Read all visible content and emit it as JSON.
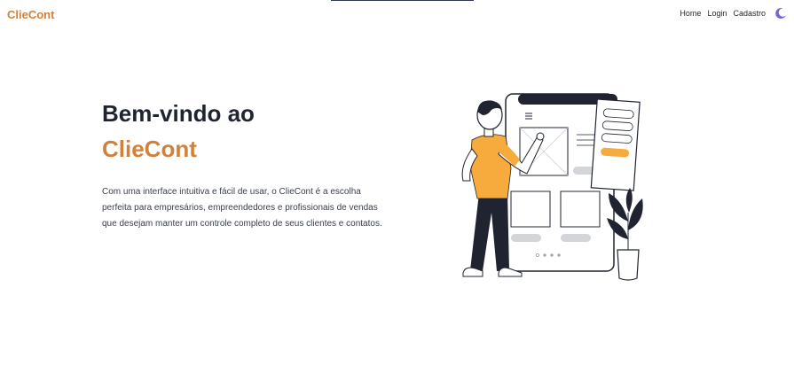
{
  "navbar": {
    "brand": "ClieCont",
    "links": [
      "Home",
      "Login",
      "Cadastro"
    ],
    "theme_toggle_icon": "moon-icon"
  },
  "hero": {
    "title_line1": "Bem-vindo ao",
    "title_line2": "ClieCont",
    "description": "Com uma interface intuitiva e fácil de usar, o ClieCont é a escolha perfeita para empresários, empreendedores e profissionais de vendas que desejam manter um controle completo de seus clientes e contatos.",
    "illustration": "person-interacting-with-app-illustration"
  },
  "colors": {
    "accent": "#d3813a",
    "illustration_orange": "#f7ab3c",
    "text_dark": "#1f2430",
    "moon": "#7b5fe0"
  }
}
